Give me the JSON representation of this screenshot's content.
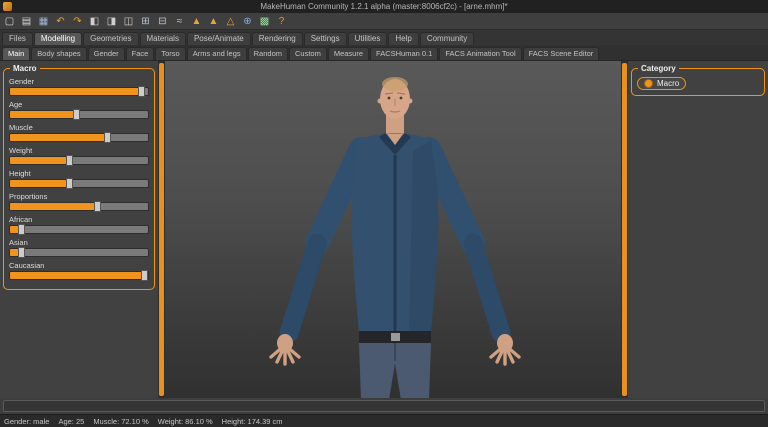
{
  "window": {
    "title": "MakeHuman Community 1.2.1 alpha (master:8006cf2c) - [arne.mhm]*"
  },
  "toolbar": {
    "icons": [
      {
        "name": "new-icon",
        "glyph": "▢",
        "color": "#d8d8d8"
      },
      {
        "name": "load-icon",
        "glyph": "▤",
        "color": "#d8d8d8"
      },
      {
        "name": "save-icon",
        "glyph": "▦",
        "color": "#9fb6d4"
      },
      {
        "name": "undo-icon",
        "glyph": "↶",
        "color": "#e8a13c"
      },
      {
        "name": "redo-icon",
        "glyph": "↷",
        "color": "#e8a13c"
      },
      {
        "name": "symmetry-left-icon",
        "glyph": "◧",
        "color": "#cfcfcf"
      },
      {
        "name": "symmetry-right-icon",
        "glyph": "◨",
        "color": "#cfcfcf"
      },
      {
        "name": "symmetry-icon",
        "glyph": "◫",
        "color": "#cfcfcf"
      },
      {
        "name": "grid-icon",
        "glyph": "⊞",
        "color": "#b8c4d0"
      },
      {
        "name": "subdivide-icon",
        "glyph": "⊟",
        "color": "#b8c4d0"
      },
      {
        "name": "smooth-icon",
        "glyph": "≈",
        "color": "#b8c4d0"
      },
      {
        "name": "top-view-icon",
        "glyph": "▲",
        "color": "#e8a13c"
      },
      {
        "name": "front-view-icon",
        "glyph": "▲",
        "color": "#e8a13c"
      },
      {
        "name": "side-view-icon",
        "glyph": "△",
        "color": "#e8a13c"
      },
      {
        "name": "globe-icon",
        "glyph": "⊕",
        "color": "#7fb2e5"
      },
      {
        "name": "grid-ground-icon",
        "glyph": "▩",
        "color": "#9fd49f"
      },
      {
        "name": "help-icon",
        "glyph": "?",
        "color": "#f0941e"
      }
    ]
  },
  "menu_tabs": {
    "active_index": 1,
    "items": [
      {
        "label": "Files"
      },
      {
        "label": "Modelling"
      },
      {
        "label": "Geometries"
      },
      {
        "label": "Materials"
      },
      {
        "label": "Pose/Animate"
      },
      {
        "label": "Rendering"
      },
      {
        "label": "Settings"
      },
      {
        "label": "Utilities"
      },
      {
        "label": "Help"
      },
      {
        "label": "Community"
      }
    ]
  },
  "sub_tabs": {
    "active_index": 0,
    "items": [
      {
        "label": "Main"
      },
      {
        "label": "Body shapes"
      },
      {
        "label": "Gender"
      },
      {
        "label": "Face"
      },
      {
        "label": "Torso"
      },
      {
        "label": "Arms and legs"
      },
      {
        "label": "Random"
      },
      {
        "label": "Custom"
      },
      {
        "label": "Measure"
      },
      {
        "label": "FACSHuman 0.1"
      },
      {
        "label": "FACS Animation Tool"
      },
      {
        "label": "FACS Scene Editor"
      }
    ]
  },
  "macro_panel": {
    "title": "Macro",
    "sliders": [
      {
        "label": "Gender",
        "fill": 95
      },
      {
        "label": "Age",
        "fill": 48
      },
      {
        "label": "Muscle",
        "fill": 70
      },
      {
        "label": "Weight",
        "fill": 43
      },
      {
        "label": "Height",
        "fill": 43
      },
      {
        "label": "Proportions",
        "fill": 63
      },
      {
        "label": "African",
        "fill": 8
      },
      {
        "label": "Asian",
        "fill": 8
      },
      {
        "label": "Caucasian",
        "fill": 97
      }
    ]
  },
  "category_panel": {
    "title": "Category",
    "options": [
      {
        "label": "Macro",
        "selected": true
      }
    ]
  },
  "status_bar": {
    "segments": [
      "Gender: male",
      "Age: 25",
      "Muscle: 72.10 %",
      "Weight: 86.10 %",
      "Height: 174.39 cm"
    ]
  },
  "colors": {
    "accent": "#ef9512",
    "slider_fill": "#f0941e",
    "slider_track": "#7a7a7a"
  }
}
